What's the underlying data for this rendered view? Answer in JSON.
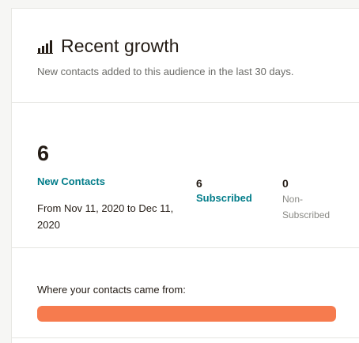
{
  "header": {
    "title": "Recent growth",
    "subtitle": "New contacts added to this audience in the last 30 days.",
    "icon": "bar-chart-icon"
  },
  "summary": {
    "total": "6",
    "total_label": "New Contacts",
    "date_range": "From Nov 11, 2020 to Dec 11, 2020"
  },
  "breakdown": {
    "subscribed_count": "6",
    "subscribed_label": "Subscribed",
    "nonsubscribed_count": "0",
    "nonsubscribed_label": "Non-Subscribed"
  },
  "sources": {
    "label": "Where your contacts came from:",
    "bar_fraction": 1.0,
    "bar_color": "#f67b4e"
  }
}
